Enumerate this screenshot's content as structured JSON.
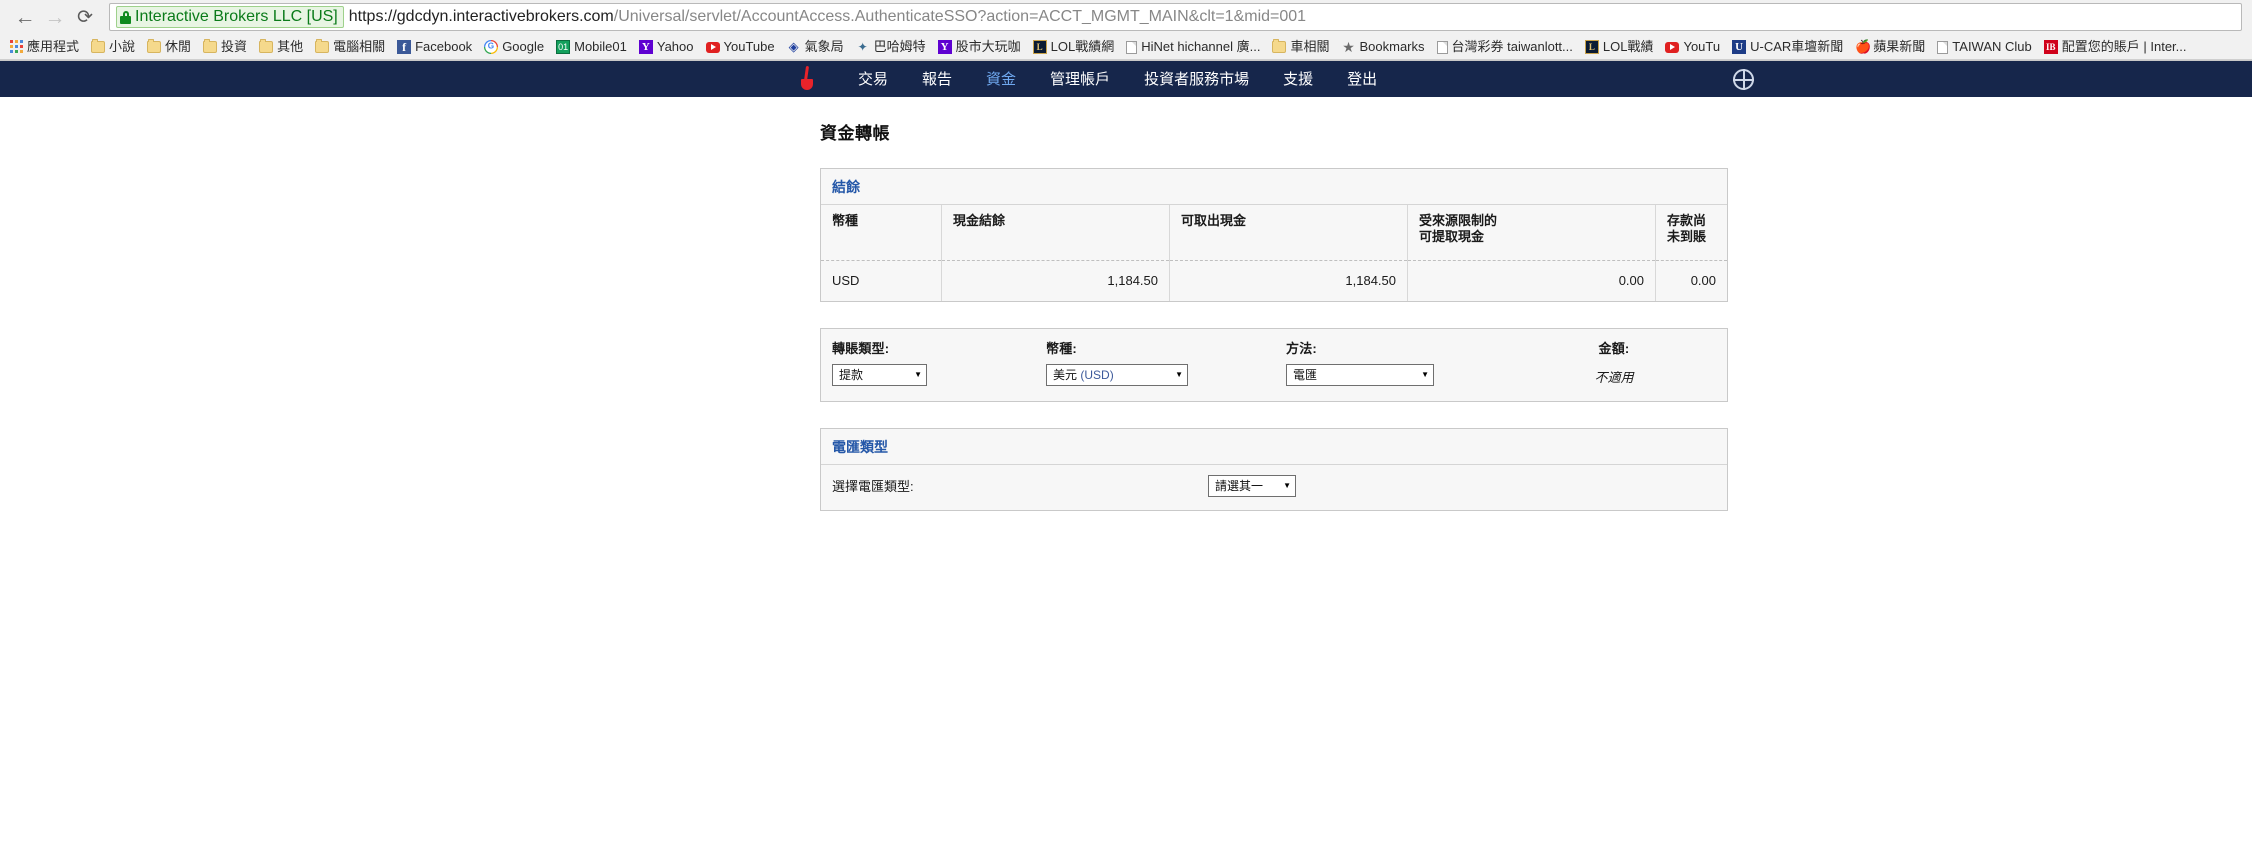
{
  "browser": {
    "back_icon": "arrow-left-icon",
    "forward_icon": "arrow-right-icon",
    "reload_icon": "reload-icon",
    "security_badge": "Interactive Brokers LLC [US]",
    "url_host": "https://gdcdyn.interactivebrokers.com",
    "url_path": "/Universal/servlet/AccountAccess.AuthenticateSSO?action=ACCT_MGMT_MAIN&clt=1&mid=001",
    "bookmarks": [
      {
        "label": "應用程式",
        "icon": "apps-grid-icon"
      },
      {
        "label": "小說",
        "icon": "folder-icon"
      },
      {
        "label": "休閒",
        "icon": "folder-icon"
      },
      {
        "label": "投資",
        "icon": "folder-icon"
      },
      {
        "label": "其他",
        "icon": "folder-icon"
      },
      {
        "label": "電腦相關",
        "icon": "folder-icon"
      },
      {
        "label": "Facebook",
        "icon": "facebook-icon"
      },
      {
        "label": "Google",
        "icon": "google-icon"
      },
      {
        "label": "Mobile01",
        "icon": "mobile01-icon"
      },
      {
        "label": "Yahoo",
        "icon": "yahoo-icon"
      },
      {
        "label": "YouTube",
        "icon": "youtube-icon"
      },
      {
        "label": "氣象局",
        "icon": "cwb-icon"
      },
      {
        "label": "巴哈姆特",
        "icon": "bahamut-icon"
      },
      {
        "label": "股市大玩咖",
        "icon": "yahoo-icon"
      },
      {
        "label": "LOL戰績網",
        "icon": "lol-icon"
      },
      {
        "label": "HiNet hichannel 廣...",
        "icon": "page-icon"
      },
      {
        "label": "車相關",
        "icon": "folder-icon"
      },
      {
        "label": "Bookmarks",
        "icon": "star-icon"
      },
      {
        "label": "台灣彩券 taiwanlott...",
        "icon": "page-icon"
      },
      {
        "label": "LOL戰績",
        "icon": "lol-icon"
      },
      {
        "label": "YouTu",
        "icon": "youtube-icon"
      },
      {
        "label": "U-CAR車壇新聞",
        "icon": "ucar-icon"
      },
      {
        "label": "蘋果新聞",
        "icon": "apple-daily-icon"
      },
      {
        "label": "TAIWAN Club",
        "icon": "page-icon"
      },
      {
        "label": "配置您的賬戶 | Inter...",
        "icon": "ib-icon"
      }
    ]
  },
  "site_nav": {
    "logo": "interactive-brokers-logo",
    "globe_icon": "globe-icon",
    "items": [
      {
        "label": "交易",
        "active": false
      },
      {
        "label": "報告",
        "active": false
      },
      {
        "label": "資金",
        "active": true
      },
      {
        "label": "管理帳戶",
        "active": false
      },
      {
        "label": "投資者服務市場",
        "active": false
      },
      {
        "label": "支援",
        "active": false
      },
      {
        "label": "登出",
        "active": false
      }
    ]
  },
  "page": {
    "title": "資金轉帳"
  },
  "balances": {
    "section_label": "結餘",
    "columns": [
      "幣種",
      "現金結餘",
      "可取出現金",
      "受來源限制的\n可提取現金",
      "存款尚未到賬"
    ],
    "rows": [
      {
        "currency": "USD",
        "cash_balance": "1,184.50",
        "available_cash": "1,184.50",
        "source_restricted": "0.00",
        "pending_deposits": "0.00"
      }
    ]
  },
  "transfer_form": {
    "transfer_type": {
      "label": "轉賬類型:",
      "value": "提款"
    },
    "currency": {
      "label": "幣種:",
      "value_name": "美元",
      "value_code": "(USD)"
    },
    "method": {
      "label": "方法:",
      "value": "電匯"
    },
    "amount": {
      "label": "金額:",
      "value": "不適用"
    }
  },
  "wire_type": {
    "section_label": "電匯類型",
    "field_label": "選擇電匯類型:",
    "value": "請選其一"
  },
  "colors": {
    "nav_background": "#16264b",
    "nav_active_link": "#6fa8ef",
    "panel_link": "#2457a8",
    "secure_green": "#0b7b1a",
    "brand_red": "#e8232a"
  }
}
